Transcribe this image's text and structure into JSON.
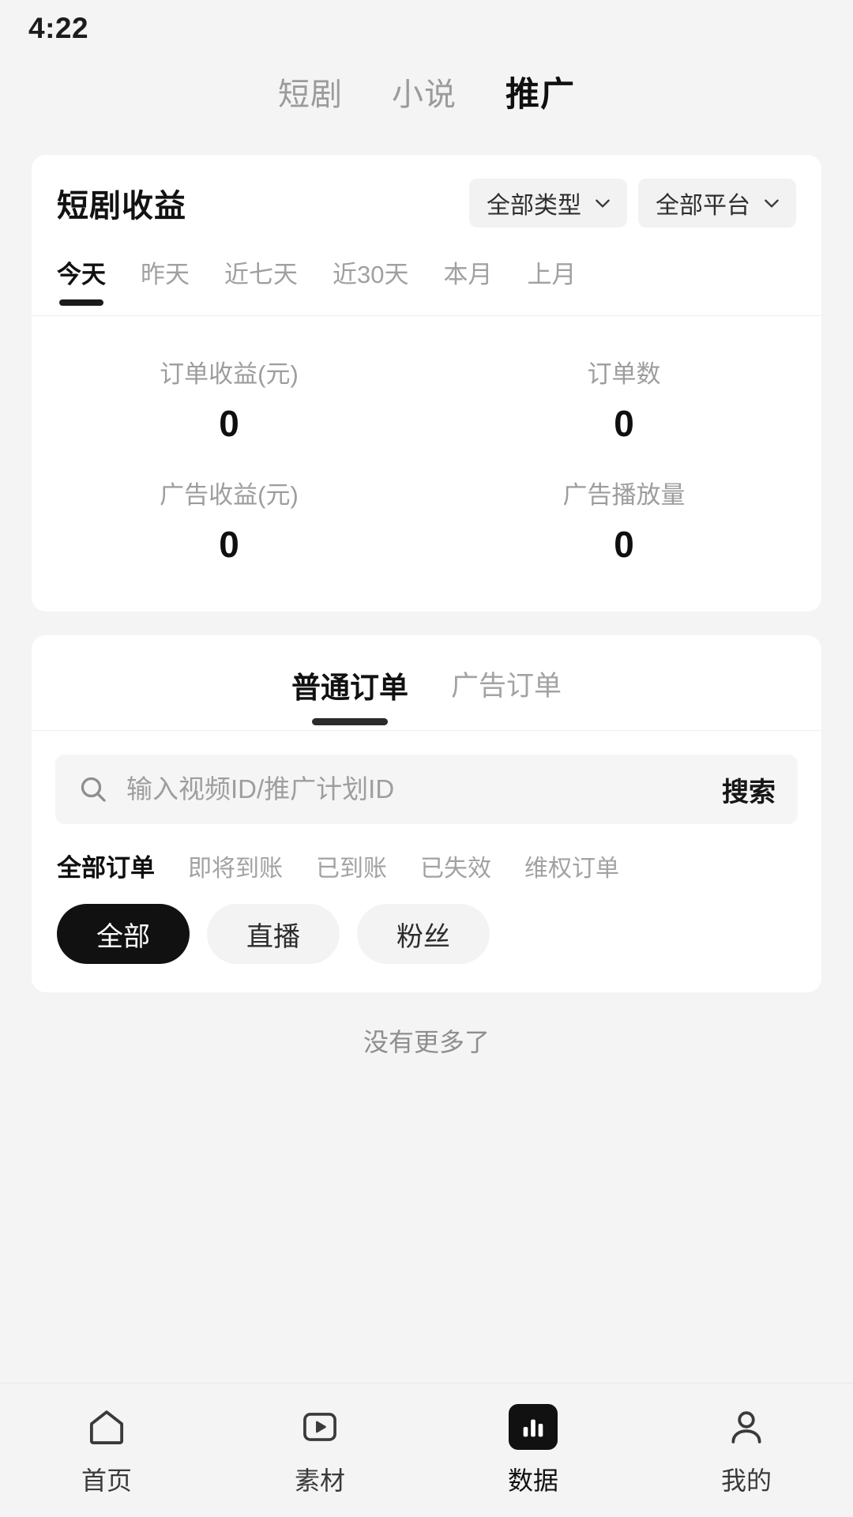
{
  "status_bar": {
    "time": "4:22"
  },
  "top_tabs": [
    {
      "label": "短剧",
      "active": false
    },
    {
      "label": "小说",
      "active": false
    },
    {
      "label": "推广",
      "active": true
    }
  ],
  "earnings_card": {
    "title": "短剧收益",
    "filters": [
      {
        "label": "全部类型",
        "icon": "chevron-down-icon"
      },
      {
        "label": "全部平台",
        "icon": "chevron-down-icon"
      }
    ],
    "period_tabs": [
      {
        "label": "今天",
        "active": true
      },
      {
        "label": "昨天",
        "active": false
      },
      {
        "label": "近七天",
        "active": false
      },
      {
        "label": "近30天",
        "active": false
      },
      {
        "label": "本月",
        "active": false
      },
      {
        "label": "上月",
        "active": false
      }
    ],
    "stats": [
      {
        "label": "订单收益(元)",
        "value": "0"
      },
      {
        "label": "订单数",
        "value": "0"
      },
      {
        "label": "广告收益(元)",
        "value": "0"
      },
      {
        "label": "广告播放量",
        "value": "0"
      }
    ]
  },
  "orders_card": {
    "tabs": [
      {
        "label": "普通订单",
        "active": true
      },
      {
        "label": "广告订单",
        "active": false
      }
    ],
    "search": {
      "placeholder": "输入视频ID/推广计划ID",
      "value": "",
      "button_label": "搜索",
      "icon": "search-icon"
    },
    "status_tabs": [
      {
        "label": "全部订单",
        "active": true
      },
      {
        "label": "即将到账",
        "active": false
      },
      {
        "label": "已到账",
        "active": false
      },
      {
        "label": "已失效",
        "active": false
      },
      {
        "label": "维权订单",
        "active": false
      }
    ],
    "chips": [
      {
        "label": "全部",
        "active": true
      },
      {
        "label": "直播",
        "active": false
      },
      {
        "label": "粉丝",
        "active": false
      }
    ]
  },
  "list_footer": {
    "text": "没有更多了"
  },
  "bottom_nav": [
    {
      "label": "首页",
      "icon": "home-icon",
      "active": false
    },
    {
      "label": "素材",
      "icon": "video-play-icon",
      "active": false
    },
    {
      "label": "数据",
      "icon": "bar-chart-icon",
      "active": true
    },
    {
      "label": "我的",
      "icon": "person-icon",
      "active": false
    }
  ],
  "colors": {
    "page_bg": "#f4f4f4",
    "card_bg": "#ffffff",
    "accent_dark": "#111111",
    "muted_text": "#9e9e9e"
  }
}
